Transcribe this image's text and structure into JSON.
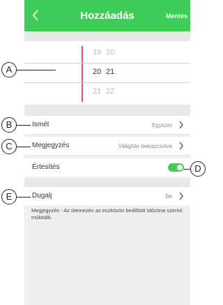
{
  "header": {
    "title": "Hozzáadás",
    "save_label": "Mentés",
    "back_icon": "chevron-left-icon"
  },
  "time_picker": {
    "rows": [
      {
        "hour": "19",
        "minute": "20",
        "state": "faded"
      },
      {
        "hour": "20",
        "minute": "21",
        "state": "selected"
      },
      {
        "hour": "21",
        "minute": "22",
        "state": "faded"
      }
    ]
  },
  "settings": {
    "repeat": {
      "label": "Ismét",
      "value": "Egyszer"
    },
    "comment": {
      "label": "Megjegyzés",
      "value": "Világítás bekapcsolva"
    },
    "notification": {
      "label": "Értesítés",
      "enabled": true
    },
    "outlet": {
      "label": "Dugalj",
      "value": "Be"
    }
  },
  "note": "Megjegyzés - Az ütemezés az eszközön beállított időzóna szerint működik.",
  "callouts": [
    "A",
    "B",
    "C",
    "D",
    "E"
  ],
  "colors": {
    "accent": "#3dcd58",
    "picker_bar": "#e54b86"
  }
}
